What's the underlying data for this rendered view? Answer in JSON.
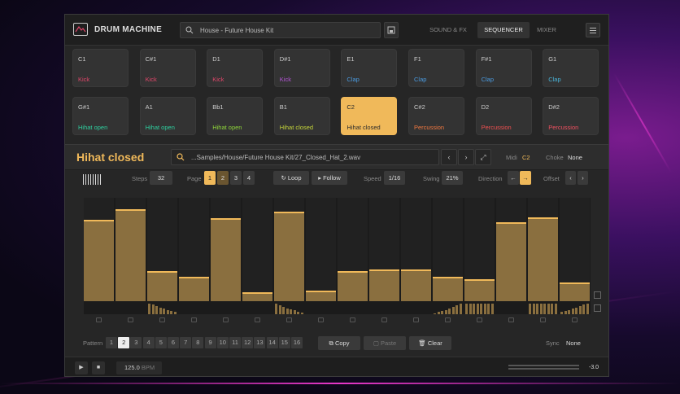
{
  "app": {
    "title": "DRUM MACHINE",
    "preset": "House - Future House Kit"
  },
  "tabs": [
    {
      "label": "SOUND & FX"
    },
    {
      "label": "SEQUENCER"
    },
    {
      "label": "MIXER"
    }
  ],
  "pads": [
    {
      "note": "C1",
      "sound": "Kick",
      "color": "#e0466a"
    },
    {
      "note": "C#1",
      "sound": "Kick",
      "color": "#e0466a"
    },
    {
      "note": "D1",
      "sound": "Kick",
      "color": "#e0466a"
    },
    {
      "note": "D#1",
      "sound": "Kick",
      "color": "#b455d6"
    },
    {
      "note": "E1",
      "sound": "Clap",
      "color": "#4b9be0"
    },
    {
      "note": "F1",
      "sound": "Clap",
      "color": "#4b9be0"
    },
    {
      "note": "F#1",
      "sound": "Clap",
      "color": "#4b9be0"
    },
    {
      "note": "G1",
      "sound": "Clap",
      "color": "#4ab4d8"
    },
    {
      "note": "G#1",
      "sound": "Hihat open",
      "color": "#2fd0a0"
    },
    {
      "note": "A1",
      "sound": "Hihat open",
      "color": "#2fd0a0"
    },
    {
      "note": "Bb1",
      "sound": "Hihat open",
      "color": "#8fd63a"
    },
    {
      "note": "B1",
      "sound": "Hihat closed",
      "color": "#c6d63a"
    },
    {
      "note": "C2",
      "sound": "Hihat closed",
      "color": "#2b2b2b",
      "selected": true
    },
    {
      "note": "C#2",
      "sound": "Percussion",
      "color": "#f07840"
    },
    {
      "note": "D2",
      "sound": "Percussion",
      "color": "#f05050"
    },
    {
      "note": "D#2",
      "sound": "Percussion",
      "color": "#f05060"
    }
  ],
  "sound": {
    "name": "Hihat closed",
    "sample_path": "...Samples/House/Future House Kit/27_Closed_Hat_2.wav",
    "midi_label": "Midi",
    "midi_value": "C2",
    "choke_label": "Choke",
    "choke_value": "None"
  },
  "sequencer": {
    "steps_label": "Steps",
    "steps_value": "32",
    "page_label": "Page",
    "pages": [
      "1",
      "2",
      "3",
      "4"
    ],
    "loop_label": "Loop",
    "follow_label": "Follow",
    "speed_label": "Speed",
    "speed_value": "1/16",
    "swing_label": "Swing",
    "swing_value": "21%",
    "direction_label": "Direction",
    "offset_label": "Offset",
    "step_levels": [
      0.79,
      0.89,
      0.29,
      0.24,
      0.8,
      0.09,
      0.87,
      0.1,
      0.29,
      0.31,
      0.31,
      0.24,
      0.21,
      0.76,
      0.81,
      0.18
    ],
    "mini_levels": [
      [
        0,
        0,
        0,
        0,
        0,
        0,
        0,
        0
      ],
      [
        0,
        0,
        0,
        0,
        0,
        0,
        0,
        0
      ],
      [
        1,
        0.9,
        0.75,
        0.6,
        0.5,
        0.4,
        0.3,
        0.2
      ],
      [
        0,
        0,
        0,
        0,
        0,
        0,
        0,
        0
      ],
      [
        0,
        0,
        0,
        0,
        0,
        0,
        0,
        0
      ],
      [
        0,
        0,
        0,
        0,
        0,
        0,
        0,
        0
      ],
      [
        1,
        0.85,
        0.7,
        0.55,
        0.45,
        0.35,
        0.25,
        0.15
      ],
      [
        0,
        0,
        0,
        0,
        0,
        0,
        0,
        0
      ],
      [
        0,
        0,
        0,
        0,
        0,
        0,
        0,
        0
      ],
      [
        0,
        0,
        0,
        0,
        0,
        0,
        0,
        0
      ],
      [
        0,
        0,
        0,
        0,
        0,
        0,
        0,
        0
      ],
      [
        0.1,
        0.2,
        0.3,
        0.4,
        0.55,
        0.7,
        0.85,
        1
      ],
      [
        1,
        1,
        1,
        1,
        1,
        1,
        1,
        1
      ],
      [
        0,
        0,
        0,
        0,
        0,
        0,
        0,
        0
      ],
      [
        1,
        1,
        1,
        1,
        1,
        1,
        1,
        1
      ],
      [
        0.2,
        0.3,
        0.4,
        0.5,
        0.6,
        0.75,
        0.9,
        1
      ]
    ]
  },
  "pattern": {
    "label": "Pattern",
    "numbers": [
      "1",
      "2",
      "3",
      "4",
      "5",
      "6",
      "7",
      "8",
      "9",
      "10",
      "11",
      "12",
      "13",
      "14",
      "15",
      "16"
    ],
    "active": "2",
    "copy_label": "Copy",
    "paste_label": "Paste",
    "clear_label": "Clear",
    "sync_label": "Sync",
    "sync_value": "None"
  },
  "transport": {
    "tempo": "125.0",
    "tempo_unit": "BPM",
    "volume": "-3.0"
  },
  "colors": {
    "accent": "#f0b95a"
  },
  "icons": [
    "logo-icon",
    "search-icon",
    "save-icon",
    "menu-icon",
    "play-icon",
    "stop-icon",
    "lock-icon"
  ]
}
